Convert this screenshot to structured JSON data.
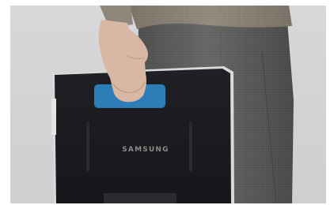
{
  "photo": {
    "subject": "person-holding-samsung-device",
    "brand_text": "SAMSUNG",
    "colors": {
      "background": "#d3d3d5",
      "sweater": "#8b8378",
      "trousers": "#5d5d5b",
      "device_body": "#1b1c20",
      "device_frame": "#cfcfcf",
      "handle_highlight": "#2f86c7",
      "skin": "#d7b7a3"
    }
  }
}
